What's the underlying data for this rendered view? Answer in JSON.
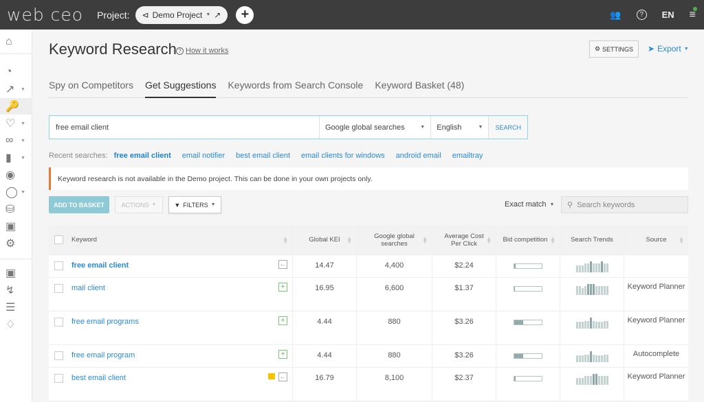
{
  "topbar": {
    "logo": "web ceo",
    "project_label": "Project:",
    "project_name": "Demo Project",
    "language": "EN",
    "icons": [
      "users-icon",
      "help-icon",
      "menu-icon"
    ]
  },
  "sidebar": {
    "items": [
      {
        "icon": "home-icon"
      },
      {
        "icon": "dashboard-icon"
      },
      {
        "icon": "rankings-icon",
        "caret": true
      },
      {
        "icon": "key-icon",
        "active": true
      },
      {
        "icon": "health-icon",
        "caret": true
      },
      {
        "icon": "link-icon",
        "caret": true
      },
      {
        "icon": "signal-icon",
        "caret": true
      },
      {
        "icon": "location-icon"
      },
      {
        "icon": "chat-icon",
        "caret": true
      },
      {
        "icon": "binoculars-icon"
      },
      {
        "icon": "calendar-icon"
      },
      {
        "icon": "settings-icon"
      },
      {
        "icon": "pdf-icon"
      },
      {
        "icon": "bolt-icon"
      },
      {
        "icon": "list-icon"
      },
      {
        "icon": "bell-icon"
      }
    ]
  },
  "page": {
    "title": "Keyword Research",
    "how_it_works": "How it works",
    "settings_label": "SETTINGS",
    "export_label": "Export"
  },
  "tabs": [
    {
      "label": "Spy on Competitors",
      "active": false
    },
    {
      "label": "Get Suggestions",
      "active": true
    },
    {
      "label": "Keywords from Search Console",
      "active": false
    },
    {
      "label": "Keyword Basket (48)",
      "active": false
    }
  ],
  "search": {
    "value": "free email client",
    "engine": "Google global searches",
    "language": "English",
    "button": "SEARCH"
  },
  "recent": {
    "label": "Recent searches:",
    "items": [
      "free email client",
      "email notifier",
      "best email client",
      "email clients for windows",
      "android email",
      "emailtray"
    ]
  },
  "alert": "Keyword research is not available in the Demo project. This can be done in your own projects only.",
  "toolbar": {
    "add_to_basket": "ADD TO BASKET",
    "actions": "ACTIONS",
    "filters": "FILTERS",
    "match": "Exact match",
    "search_placeholder": "Search keywords"
  },
  "table": {
    "headers": [
      "Keyword",
      "Global KEI",
      "Google global searches",
      "Average Cost Per Click",
      "Bid competition",
      "Search Trends",
      "Source"
    ],
    "rows": [
      {
        "keyword": "free email client",
        "bold": true,
        "action": "remove",
        "flag": false,
        "kei": "14.47",
        "searches": "4,400",
        "cpc": "$2.24",
        "bid": 0.05,
        "trend": [
          0.65,
          0.65,
          0.65,
          0.8,
          0.8,
          1,
          0.8,
          0.8,
          0.8,
          1,
          0.8,
          0.8
        ],
        "source": ""
      },
      {
        "keyword": "mail client",
        "bold": false,
        "action": "add",
        "flag": false,
        "kei": "16.95",
        "searches": "6,600",
        "cpc": "$1.37",
        "bid": 0.03,
        "trend": [
          0.8,
          0.8,
          0.6,
          0.8,
          1,
          1,
          1,
          0.8,
          0.8,
          0.8,
          0.8,
          0.8
        ],
        "source": "Keyword Planner"
      },
      {
        "keyword": "free email programs",
        "bold": false,
        "action": "add",
        "flag": false,
        "kei": "4.44",
        "searches": "880",
        "cpc": "$3.26",
        "bid": 0.32,
        "trend": [
          0.6,
          0.6,
          0.6,
          0.7,
          0.7,
          1,
          0.7,
          0.6,
          0.6,
          0.6,
          0.7,
          0.7
        ],
        "source": "Keyword Planner"
      },
      {
        "keyword": "free email program",
        "bold": false,
        "action": "add",
        "flag": false,
        "kei": "4.44",
        "searches": "880",
        "cpc": "$3.26",
        "bid": 0.32,
        "trend": [
          0.6,
          0.6,
          0.6,
          0.7,
          0.7,
          1,
          0.7,
          0.6,
          0.6,
          0.6,
          0.7,
          0.7
        ],
        "source": "Autocomplete"
      },
      {
        "keyword": "best email client",
        "bold": false,
        "action": "remove",
        "flag": true,
        "kei": "16.79",
        "searches": "8,100",
        "cpc": "$2.37",
        "bid": 0.06,
        "trend": [
          0.6,
          0.6,
          0.6,
          0.8,
          0.8,
          0.8,
          1,
          1,
          0.8,
          0.8,
          0.8,
          0.8
        ],
        "source": "Keyword Planner"
      }
    ]
  }
}
